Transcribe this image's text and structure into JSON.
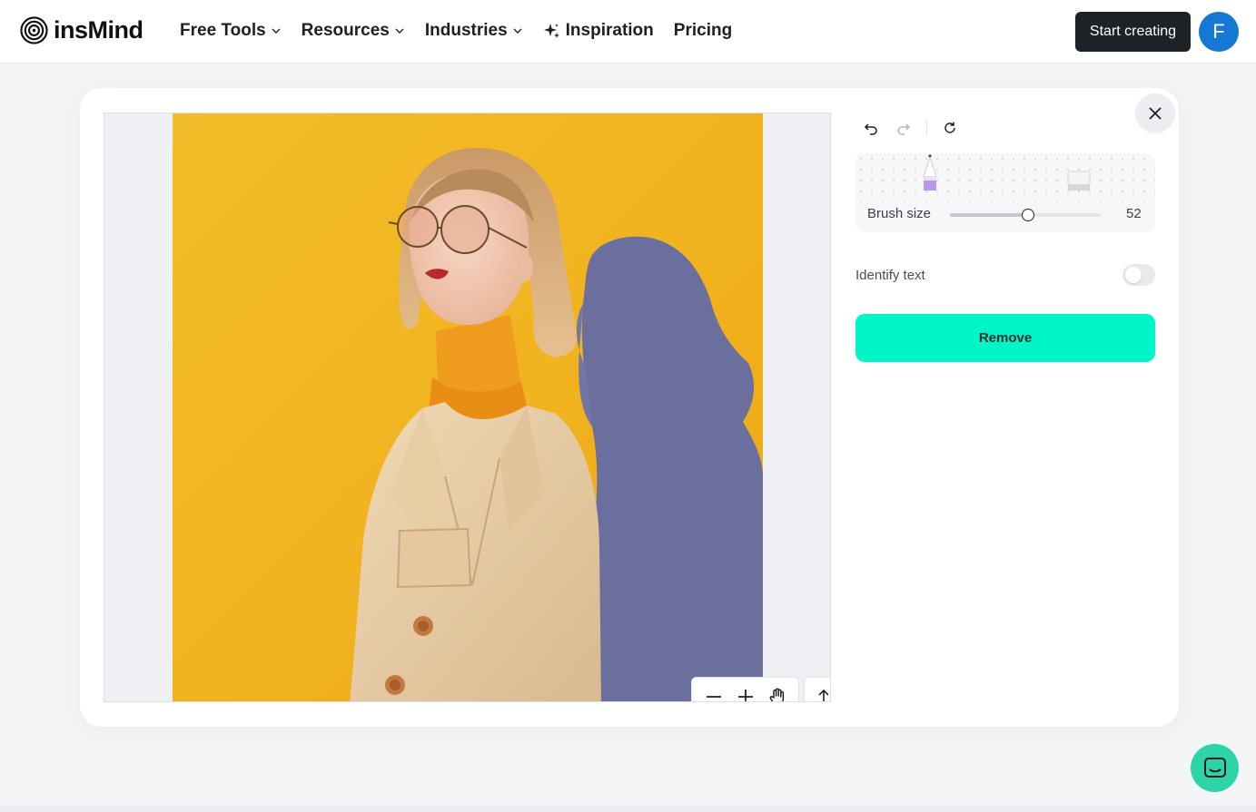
{
  "header": {
    "logo_text": "insMind",
    "nav": [
      {
        "label": "Free Tools",
        "has_dropdown": true
      },
      {
        "label": "Resources",
        "has_dropdown": true
      },
      {
        "label": "Industries",
        "has_dropdown": true
      },
      {
        "label": "Inspiration",
        "icon": "sparkle-icon"
      },
      {
        "label": "Pricing"
      }
    ],
    "start_button": "Start creating",
    "avatar_initial": "F"
  },
  "editor": {
    "history": {
      "undo": "undo-icon",
      "redo": "redo-icon",
      "reset": "reset-icon"
    },
    "tools": {
      "brush": "pencil-icon",
      "eraser": "eraser-icon"
    },
    "brush_size_label": "Brush size",
    "brush_size_value": "52",
    "brush_size_fraction": 0.52,
    "identify_text_label": "Identify text",
    "identify_text_on": false,
    "remove_button": "Remove",
    "zoom_controls": [
      "zoom-out-icon",
      "zoom-in-icon",
      "hand-icon"
    ],
    "upload_icon": "upload-icon"
  },
  "colors": {
    "accent": "#00f5c8",
    "dark_button": "#1e2227",
    "avatar": "#1578d4",
    "chat": "#2dd4a8",
    "mask": "#6b6f9e"
  }
}
